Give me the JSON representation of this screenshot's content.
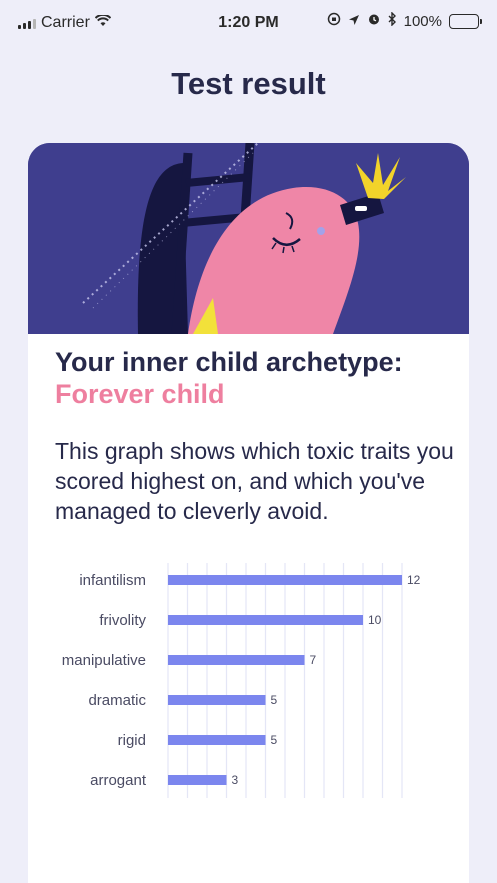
{
  "status_bar": {
    "carrier": "Carrier",
    "time": "1:20 PM",
    "battery": "100%"
  },
  "header": {
    "title": "Test result"
  },
  "result": {
    "heading": "Your inner child archetype:",
    "archetype": "Forever child",
    "description": "This graph shows which toxic traits you scored highest on, and which you've managed to cleverly avoid."
  },
  "colors": {
    "background": "#eeeef9",
    "hero": "#3f3e8e",
    "accent_pink": "#ee7f9f",
    "bar": "#7b86ee",
    "text": "#27294a"
  },
  "chart_data": {
    "type": "bar",
    "orientation": "horizontal",
    "categories": [
      "infantilism",
      "frivolity",
      "manipulative",
      "dramatic",
      "rigid",
      "arrogant"
    ],
    "values": [
      12,
      10,
      7,
      5,
      5,
      3
    ],
    "xlim": [
      0,
      12
    ],
    "grid": true,
    "title": "",
    "xlabel": "",
    "ylabel": ""
  }
}
